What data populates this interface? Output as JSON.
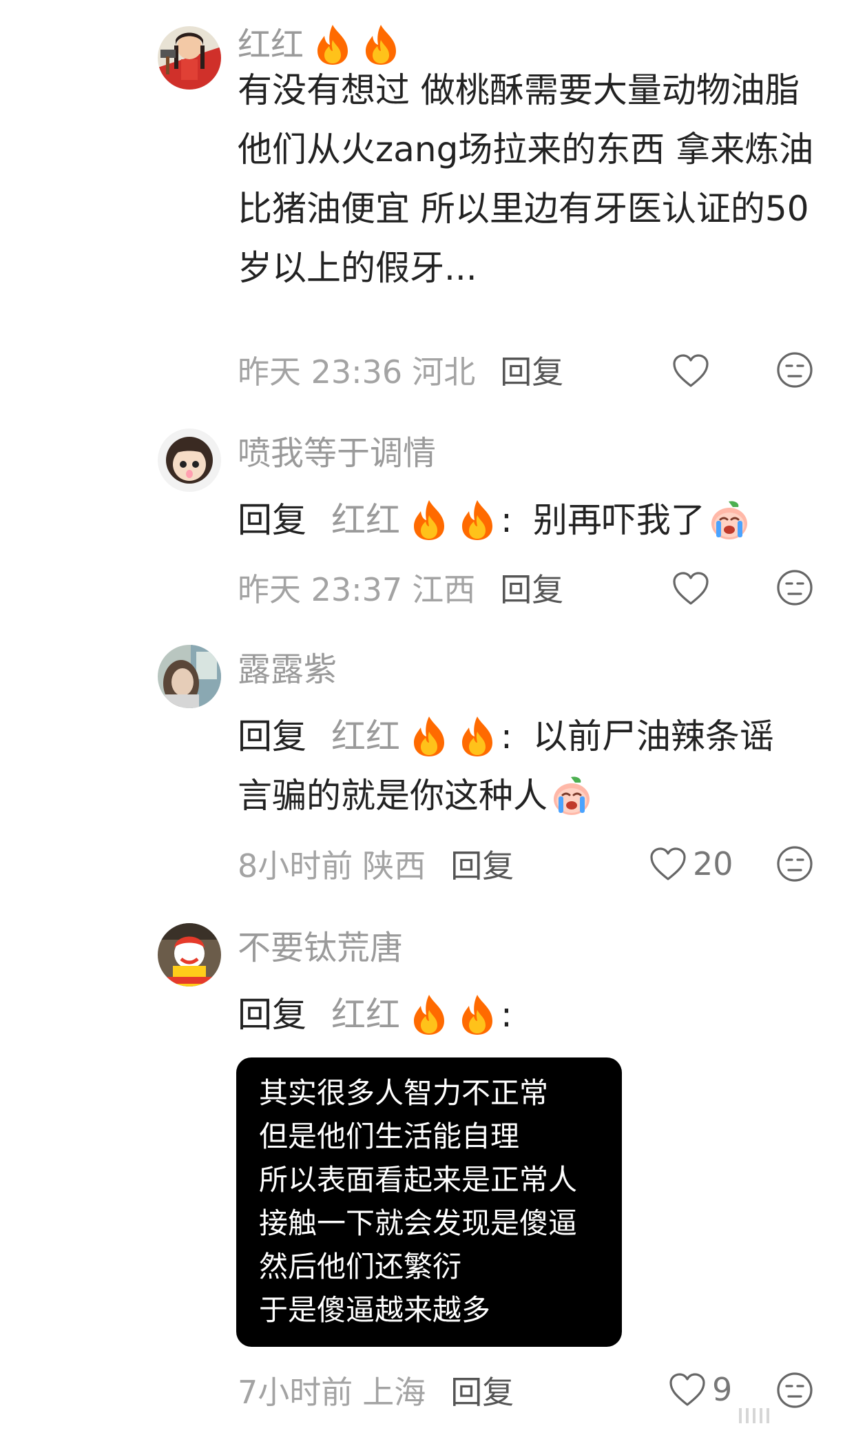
{
  "comments": [
    {
      "username": "红红",
      "text": "有没有想过 做桃酥需要大量动物油脂 他们从火zang场拉来的东西 拿来炼油 比猪油便宜 所以里边有牙医认证的50岁以上的假牙...",
      "time": "昨天 23:36",
      "location": "河北",
      "reply_label": "回复",
      "likes": ""
    },
    {
      "username": "喷我等于调情",
      "reply_prefix": "回复",
      "reply_to": "红红",
      "text": "别再吓我了",
      "time": "昨天 23:37",
      "location": "江西",
      "reply_label": "回复",
      "likes": ""
    },
    {
      "username": "露露紫",
      "reply_prefix": "回复",
      "reply_to": "红红",
      "text_line1": "以前尸油辣条谣",
      "text_line2": "言骗的就是你这种人",
      "time": "8小时前",
      "location": "陕西",
      "reply_label": "回复",
      "likes": "20"
    },
    {
      "username": "不要钛荒唐",
      "reply_prefix": "回复",
      "reply_to": "红红",
      "image_text": [
        "其实很多人智力不正常",
        "但是他们生活能自理",
        "所以表面看起来是正常人",
        "接触一下就会发现是傻逼",
        "然后他们还繁衍",
        "于是傻逼越来越多"
      ],
      "time": "7小时前",
      "location": "上海",
      "reply_label": "回复",
      "likes": "9"
    }
  ],
  "icons": {
    "fire": "fire-emoji-icon",
    "crying": "crying-face-icon",
    "like": "heart-outline-icon",
    "dislike": "neutral-face-icon"
  },
  "colors": {
    "text": "#222222",
    "muted": "#9a9a9a",
    "background": "#ffffff",
    "image_bg": "#000000"
  }
}
